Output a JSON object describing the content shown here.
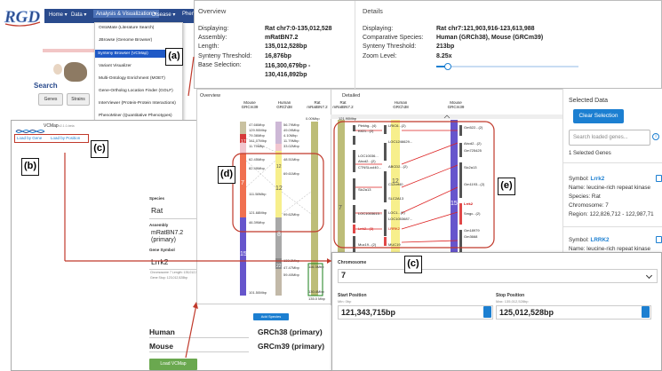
{
  "rgd": {
    "logo": "RGD",
    "nav": [
      "Home ▾",
      "Data ▾",
      "Analysis & Visualization ▾",
      "Disease ▾",
      "Phen"
    ],
    "menu": [
      "OntoMate (Literature Search)",
      "JBrowse (Genome Browser)",
      "Synteny Browser (VCMap)",
      "Variant Visualizer",
      "Multi-Ontology Enrichment (MOET)",
      "Gene-Ortholog Location Finder (GOLF)",
      "InterViewer (Protein-Protein Interactions)",
      "PhenoMiner (Quantitative Phenotypes)"
    ],
    "menu_badge": "(a)",
    "search_label": "Search",
    "search_tabs": [
      "Genes",
      "Strains"
    ]
  },
  "vcmap": {
    "logo": "VCMap",
    "version": "v2.1.0-beta",
    "load_by_gene": "Load by Gene",
    "load_by_position": "Load by Position",
    "species_label": "Species",
    "species_value": "Rat",
    "assembly_label": "Assembly",
    "assembly_value": "mRatBN7.2 (primary)",
    "gene_label": "Gene Symbol",
    "gene_value": "Lrrk2",
    "chr_info": [
      "Chromosome 7 Length: 135,012,528bp",
      "Gene Stop: 123,012,528bp"
    ],
    "add_species": "Add Species",
    "comparisons": [
      {
        "species": "Human",
        "assembly": "GRCh38 (primary)",
        "remove": "Remove"
      },
      {
        "species": "Mouse",
        "assembly": "GRCm39 (primary)",
        "remove": "Remove"
      }
    ],
    "load_button": "Load VCMap"
  },
  "overview_header": {
    "overview_title": "Overview",
    "details_title": "Details",
    "overview": [
      {
        "k": "Displaying:",
        "v": "Rat chr7:0-135,012,528"
      },
      {
        "k": "Assembly:",
        "v": "mRatBN7.2"
      },
      {
        "k": "Length:",
        "v": "135,012,528bp"
      },
      {
        "k": "Synteny Threshold:",
        "v": "16,876bp"
      },
      {
        "k": "Base Selection:",
        "v": "116,300,679bp - 130,416,892bp"
      }
    ],
    "details": [
      {
        "k": "Displaying:",
        "v": "Rat chr7:121,903,916-123,613,988"
      },
      {
        "k": "Comparative Species:",
        "v": "Human (GRCh38), Mouse (GRCm39)"
      },
      {
        "k": "Synteny Threshold:",
        "v": "213bp"
      },
      {
        "k": "Zoom Level:",
        "v": "8.25x"
      }
    ]
  },
  "overview_panel": {
    "title": "Overview",
    "species": [
      {
        "name": "Mouse",
        "assembly": "GRCm39"
      },
      {
        "name": "Human",
        "assembly": "GRCh38"
      },
      {
        "name": "Rat",
        "assembly": "mRatBN7.2"
      }
    ],
    "mouse_positions": [
      "47.66Mbp",
      "129.90Mbp",
      "79.36Mbp",
      "141.07Mbp",
      "11.75Mbp",
      "53.48Mbp",
      "62.45Mbp",
      "62.49Mbp",
      "82.49Mbp",
      "111.58Mbp",
      "121.68Mbp",
      "46.39Mbp",
      "101.50Mbp"
    ],
    "human_positions": [
      "56.79Mbp",
      "49.09Mbp",
      "4.10Mbp",
      "11.79Mbp",
      "33.02Mbp",
      "48.51Mbp",
      "69.61Mbp",
      "99.62Mbp",
      "29.43Mbp",
      "57.91Mbp",
      "133.3Mbp",
      "47.47Mbp",
      "59.40Mbp"
    ],
    "rat_positions": [
      "0.00Mbp",
      "116.3Mbp",
      "130.4Mbp",
      "135.0 Mbp"
    ],
    "block_numbers": [
      "17",
      "7",
      "15",
      "15",
      "12",
      "12",
      "8",
      "19",
      "22",
      "8"
    ]
  },
  "detailed_panel": {
    "title": "Detailed",
    "species": [
      {
        "name": "Rat",
        "assembly": "mRatBN7.2"
      },
      {
        "name": "Human",
        "assembly": "GRCh38"
      },
      {
        "name": "Mouse",
        "assembly": "GRCm39"
      }
    ],
    "rat_top": "121.90Mbp",
    "rat_genes": [
      "Plekhg...(4)",
      "Kif21...(2)",
      "LOC10036...",
      "Abcd2...(2)",
      "CTNSLocl40...",
      "Slc2a13",
      "LOC1003615...",
      "Lrrk2...(3)",
      "Muc19...(2)"
    ],
    "human_genes": [
      "LRIC6...(2)",
      "LOC1246629...",
      "ABCD2...(2)",
      "C12orf40",
      "SLC2A13",
      "LOC1...(2)",
      "LOC1053687...",
      "LRRK2",
      "MUC19"
    ],
    "mouse_genes": [
      "Gm522...(2)",
      "Abcd2...(2)",
      "Gm725425",
      "Slc2a13",
      "Gm1193...(2)",
      "Lrrk2",
      "Smgc...(2)",
      "Gm18979",
      "Gm3668"
    ],
    "block_number": "7",
    "human_block": "12",
    "mouse_block": "15"
  },
  "selected_panel": {
    "title": "Selected Data",
    "clear_button": "Clear Selection",
    "search_placeholder": "Search loaded genes...",
    "count": "1 Selected Genes",
    "gene1": {
      "symbol_label": "Symbol:",
      "symbol": "Lrrk2",
      "name": "Name: leucine-rich repeat kinase",
      "species": "Species: Rat",
      "chromosome": "Chromosome: 7",
      "region": "Region: 122,826,712 - 122,987,71"
    },
    "gene2": {
      "symbol_label": "Symbol:",
      "symbol": "LRRK2",
      "name": "Name: leucine-rich repeat kinase"
    }
  },
  "chromosome_popup": {
    "chromosome_label": "Chromosome",
    "chromosome_value": "7",
    "start_label": "Start Position",
    "start_sub": "Min: 0bp",
    "start_value": "121,343,715bp",
    "stop_label": "Stop Position",
    "stop_sub": "Max: 135,012,528bp",
    "stop_value": "125,012,528bp"
  },
  "callouts": {
    "a": "(a)",
    "b": "(b)",
    "c_top": "(c)",
    "c_popup": "(c)",
    "d": "(d)",
    "e": "(e)"
  },
  "colors": {
    "rgd_nav": "#2a4b8d",
    "accent": "#1c7fd1",
    "annotation_red": "#c0392b",
    "rat_chr": "#bdbd78",
    "human_chr": "#f7ef8c"
  }
}
